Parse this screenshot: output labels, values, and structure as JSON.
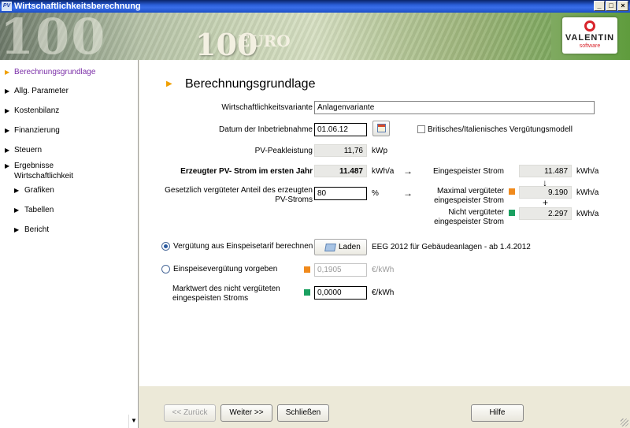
{
  "window": {
    "title": "Wirtschaftlichkeitsberechnung",
    "app_icon_text": "PV",
    "controls": [
      "_",
      "□",
      "×"
    ]
  },
  "banner": {
    "note_value": "100",
    "note_currency": "EURO",
    "logo_name": "VALENTIN",
    "logo_sub": "software"
  },
  "sidebar": {
    "items": [
      {
        "label": "Berechnungsgrundlage",
        "active": true
      },
      {
        "label": "Allg. Parameter"
      },
      {
        "label": "Kostenbilanz"
      },
      {
        "label": "Finanzierung"
      },
      {
        "label": "Steuern"
      },
      {
        "label": "Ergebnisse Wirtschaftlichkeit"
      },
      {
        "label": "Grafiken"
      },
      {
        "label": "Tabellen"
      },
      {
        "label": "Bericht"
      }
    ],
    "scroll_arrow": "▼"
  },
  "main": {
    "title": "Berechnungsgrundlage",
    "variant_label": "Wirtschaftlichkeitsvariante",
    "variant_value": "Anlagenvariante",
    "date_label": "Datum der Inbetriebnahme",
    "date_value": "01.06.12",
    "british_label": "Britisches/Italienisches Vergütungsmodell",
    "british_checked": false,
    "peak_label": "PV-Peakleistung",
    "peak_value": "11,76",
    "peak_unit": "kWp",
    "yield_label": "Erzeugter PV- Strom im ersten Jahr",
    "yield_value": "11.487",
    "yield_unit": "kWh/a",
    "share_label": "Gesetzlich vergüteter Anteil des erzeugten PV-Stroms",
    "share_value": "80",
    "share_unit": "%",
    "fed_label": "Eingespeister Strom",
    "fed_value": "11.487",
    "fed_unit": "kWh/a",
    "down_arrow": "↓",
    "max_label": "Maximal vergüteter eingespeister Strom",
    "max_value": "9.190",
    "max_unit": "kWh/a",
    "plus_sign": "+",
    "nonpaid_label": "Nicht vergüteter eingespeister Strom",
    "nonpaid_value": "2.297",
    "nonpaid_unit": "kWh/a",
    "right_arrow": "→",
    "radio_tariff_label": "Vergütung aus Einspeisetarif berechnen",
    "load_button": "Laden",
    "tariff_name": "EEG 2012 für Gebäudeanlagen - ab 1.4.2012",
    "radio_manual_label": "Einspeisevergütung vorgeben",
    "manual_value": "0,1905",
    "manual_unit": "€/kWh",
    "market_label": "Marktwert des nicht vergüteten eingespeisten Stroms",
    "market_value": "0,0000",
    "market_unit": "€/kWh"
  },
  "footer": {
    "back": "<< Zurück",
    "next": "Weiter >>",
    "close": "Schließen",
    "help": "Hilfe"
  },
  "colors": {
    "accent_orange": "#f08a1c",
    "accent_green": "#1aa060",
    "active_nav": "#7b2fa8"
  }
}
